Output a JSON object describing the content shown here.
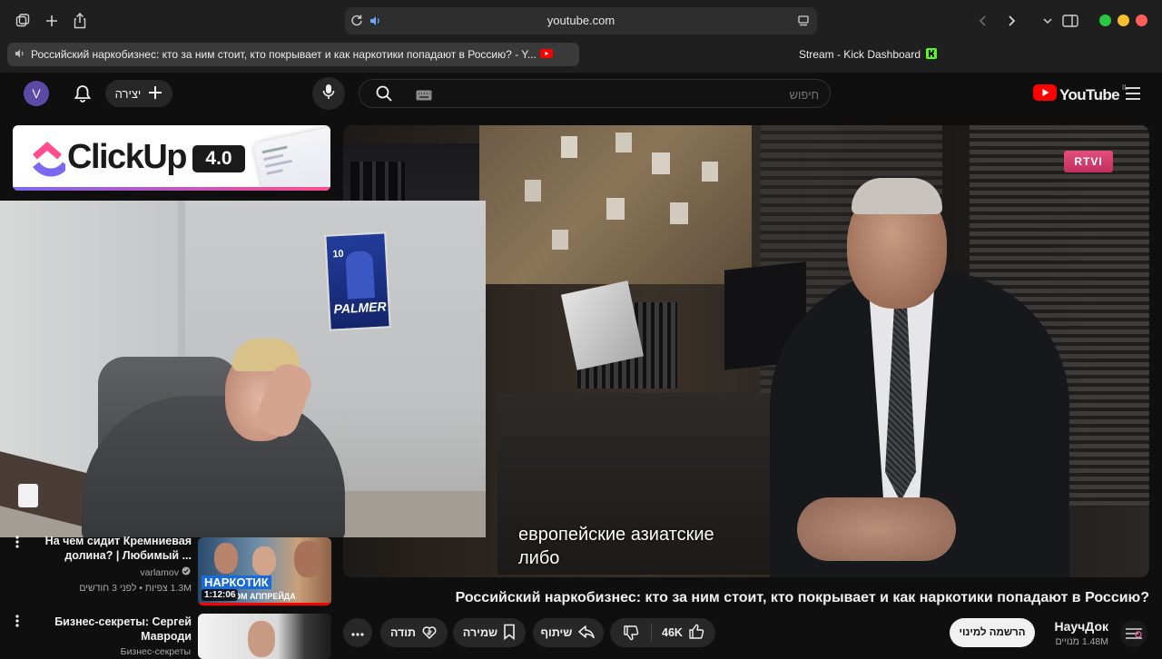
{
  "browser": {
    "url": "youtube.com",
    "tabs": [
      {
        "title": "Российский наркобизнес: кто за ним стоит, кто покрывает и как наркотики попадают в Россию? - Y..."
      },
      {
        "title": "Stream - Kick Dashboard"
      }
    ]
  },
  "header": {
    "avatar_letter": "V",
    "create_label": "יצירה",
    "search_placeholder": "חיפוש",
    "logo_text": "YouTube",
    "country": "IL"
  },
  "ad": {
    "brand": "ClickUp",
    "version": "4.0"
  },
  "webcam": {
    "poster_number": "10",
    "poster_name": "PALMER"
  },
  "video": {
    "channel_bug": "RTVI",
    "subtitle_line1": "европейские азиатские",
    "subtitle_line2": "либо",
    "title": "Российский наркобизнес: кто за ним стоит, кто покрывает и как наркотики попадают в Россию?"
  },
  "actions": {
    "likes": "46K",
    "share": "שיתוף",
    "save": "שמירה",
    "thanks": "תודה"
  },
  "channel": {
    "name": "НаучДок",
    "subscribers": "1.48M מנויים",
    "subscribe_label": "הרשמה למינוי"
  },
  "related": [
    {
      "title_line1": "На чем сидит Кремниевая",
      "title_line2": "долина? | Любимый ...",
      "channel": "varlamov",
      "meta": "1.3M צפיות • לפני 3 חודשים",
      "duration": "1:12:06",
      "thumb_text": "НАРКОТИК",
      "thumb_sub": "ОМ АППРЕЙДА"
    },
    {
      "title_line1": "Бизнес-секреты: Сергей",
      "title_line2": "Мавроди",
      "channel": "Бизнес-секреты"
    }
  ],
  "colors": {
    "youtube_red": "#ff0000",
    "background": "#0f0f0f",
    "pill": "#272727",
    "kick_green": "#53fc18"
  }
}
